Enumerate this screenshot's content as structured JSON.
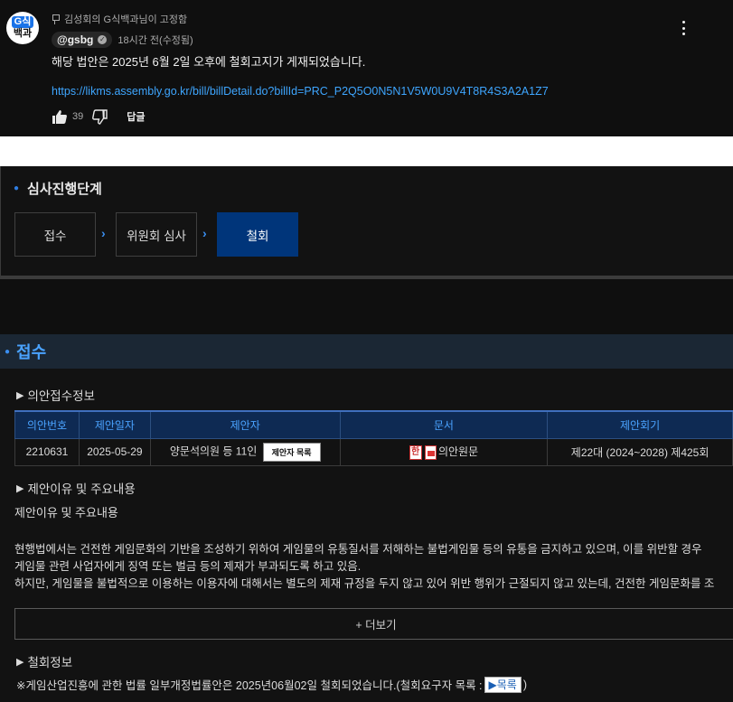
{
  "comment": {
    "avatar": {
      "line1": "G식",
      "line2": "백과"
    },
    "pinned_text": "김성회의 G식백과님이 고정함",
    "author": "@gsbg",
    "timestamp": "18시간 전(수정됨)",
    "text": "해당 법안은 2025년 6월 2일 오후에 철회고지가 게재되었습니다.",
    "link": "https://likms.assembly.go.kr/bill/billDetail.do?billId=PRC_P2Q5O0N5N1V5W0U9V4T8R4S3A2A1Z7",
    "like_count": "39",
    "reply_label": "답글"
  },
  "stage": {
    "heading": "심사진행단계",
    "steps": [
      "접수",
      "위원회 심사",
      "철회"
    ],
    "active_step": 2
  },
  "receipt": {
    "heading": "접수",
    "bill_info_label": "의안접수정보",
    "table": {
      "headers": [
        "의안번호",
        "제안일자",
        "제안자",
        "문서",
        "제안회기"
      ],
      "row": {
        "bill_no": "2210631",
        "date": "2025-05-29",
        "proposer": "양문석의원 등 11인",
        "proposer_button": "제안자 목록",
        "hwp_label": "한",
        "document": "의안원문",
        "session": "제22대 (2024~2028) 제425회"
      }
    },
    "reason_label": "제안이유 및 주요내용",
    "reason_title": "제안이유 및 주요내용",
    "body_lines": [
      "현행법에서는 건전한 게임문화의 기반을 조성하기 위하여 게임물의 유통질서를 저해하는 불법게임물 등의 유통을 금지하고 있으며, 이를 위반할 경우",
      "게임물 관련 사업자에게 징역 또는 벌금 등의 제재가 부과되도록 하고 있음.",
      "하지만, 게임물을 불법적으로 이용하는 이용자에 대해서는 별도의 제재 규정을 두지 않고 있어 위반 행위가 근절되지 않고 있는데, 건전한 게임문화를 조"
    ],
    "more_button": "+ 더보기",
    "withdraw_label": "철회정보",
    "withdraw_notice_pre": "※게임산업진흥에 관한 법률 일부개정법률안은 2025년06월02일 철회되었습니다.(철회요구자 목록 :",
    "withdraw_list_button": "▶목록",
    "withdraw_notice_post": ")"
  }
}
